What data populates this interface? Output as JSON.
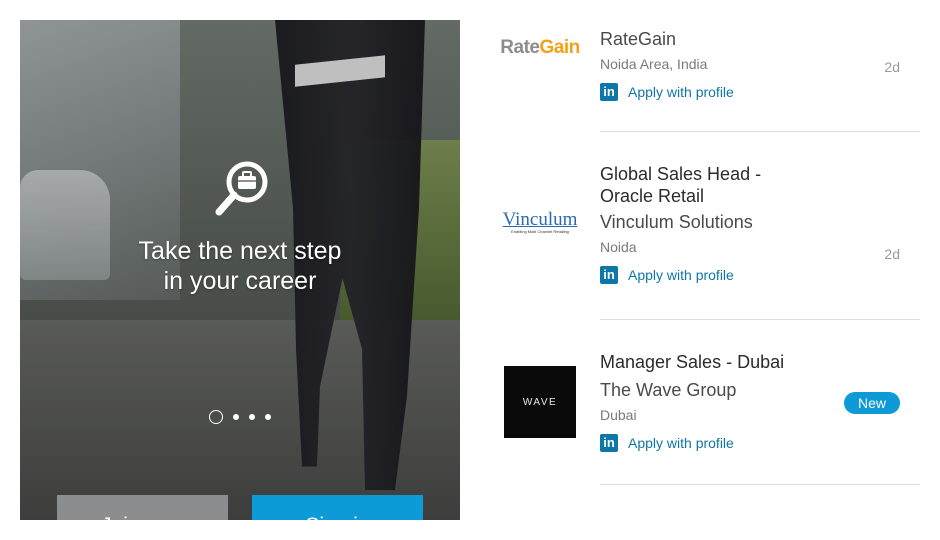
{
  "onboarding": {
    "headline_line1": "Take the next step",
    "headline_line2": "in your career",
    "join_label": "Join now",
    "signin_label": "Sign in",
    "icon": "job-search-icon",
    "page_count": 4,
    "active_page": 1
  },
  "jobs": [
    {
      "logo_text_1": "Rate",
      "logo_text_2": "Gain",
      "title": "",
      "company": "RateGain",
      "location": "Noida Area, India",
      "age": "2d",
      "apply": "Apply with profile"
    },
    {
      "logo_text": "Vinculum",
      "logo_tagline": "Enabling Multi Channel Retailing",
      "title": "Global Sales Head - Oracle Retail",
      "company": "Vinculum Solutions",
      "location": "Noida",
      "age": "2d",
      "apply": "Apply with profile"
    },
    {
      "logo_text": "WAVE",
      "title": "Manager Sales - Dubai",
      "company": "The Wave Group",
      "location": "Dubai",
      "badge": "New",
      "apply": "Apply with profile"
    }
  ],
  "linkedin_icon_text": "in",
  "colors": {
    "accent": "#0e9ad6",
    "linkedin": "#0e76a8",
    "join_button": "#8b8d8f"
  }
}
